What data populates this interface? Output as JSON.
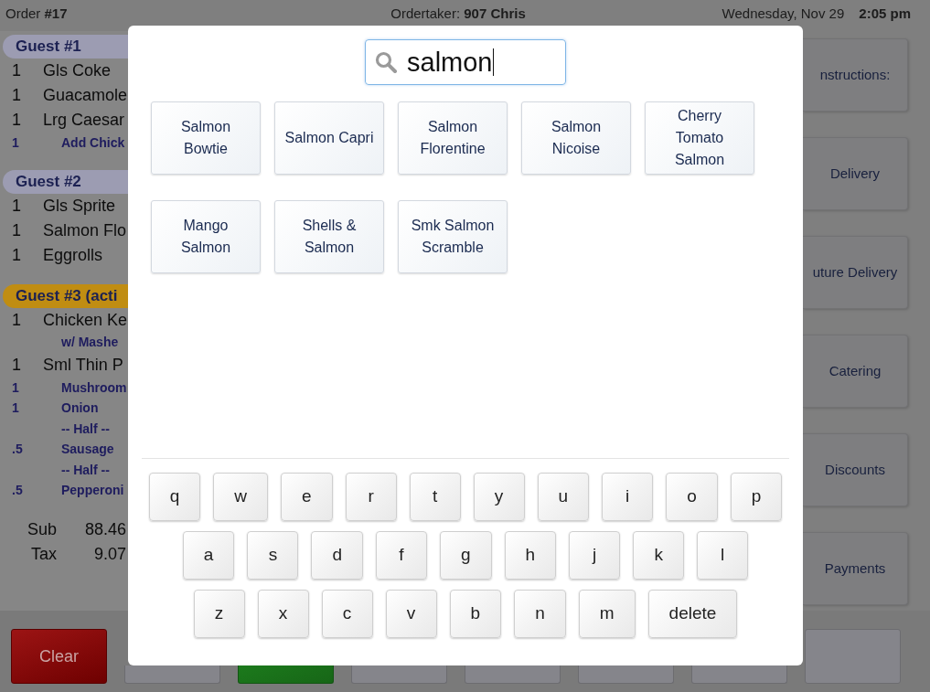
{
  "header": {
    "order": "Order **#17**",
    "ordertaker": "Ordertaker: **907 Chris**",
    "date": "Wednesday, Nov 29",
    "time": "2:05 pm"
  },
  "order_panel": {
    "guests": [
      {
        "label": "Guest #1",
        "active": false,
        "lines": [
          {
            "kind": "item",
            "qty": "1",
            "name": "Gls Coke"
          },
          {
            "kind": "item",
            "qty": "1",
            "name": "Guacamole"
          },
          {
            "kind": "item",
            "qty": "1",
            "name": "Lrg Caesar"
          },
          {
            "kind": "modifier",
            "qty": "1",
            "name": "Add Chick"
          }
        ]
      },
      {
        "label": "Guest #2",
        "active": false,
        "lines": [
          {
            "kind": "item",
            "qty": "1",
            "name": "Gls Sprite"
          },
          {
            "kind": "item",
            "qty": "1",
            "name": "Salmon Flo"
          },
          {
            "kind": "item",
            "qty": "1",
            "name": "Eggrolls"
          }
        ]
      },
      {
        "label": "Guest #3 (acti",
        "active": true,
        "lines": [
          {
            "kind": "item",
            "qty": "1",
            "name": "Chicken Ke"
          },
          {
            "kind": "modifier",
            "name": "w/ Mashe"
          },
          {
            "kind": "item",
            "qty": "1",
            "name": "Sml Thin P"
          },
          {
            "kind": "modifier",
            "qty": "1",
            "name": "Mushroom"
          },
          {
            "kind": "modifier",
            "qty": "1",
            "name": "Onion"
          },
          {
            "kind": "modifier",
            "name": "-- Half --"
          },
          {
            "kind": "modifier",
            "qty": ".5",
            "name": "Sausage"
          },
          {
            "kind": "modifier",
            "name": "-- Half --"
          },
          {
            "kind": "modifier",
            "qty": ".5",
            "name": "Pepperoni"
          }
        ]
      }
    ],
    "totals": [
      {
        "label": "Sub",
        "value": "88.46"
      },
      {
        "label": "Tax",
        "value": "9.07"
      }
    ]
  },
  "side_buttons": [
    {
      "label": "nstructions:"
    },
    {
      "label": "Delivery"
    },
    {
      "label": "uture Delivery"
    },
    {
      "label": "Catering"
    },
    {
      "label": "Discounts"
    },
    {
      "label": "Payments"
    }
  ],
  "footer_buttons": [
    {
      "kind": "danger",
      "label": "Clear"
    },
    {
      "kind": "plain"
    },
    {
      "kind": "confirm"
    },
    {
      "kind": "plain"
    },
    {
      "kind": "plain"
    },
    {
      "kind": "plain"
    },
    {
      "kind": "plain"
    },
    {
      "kind": "plain"
    }
  ],
  "search_dialog": {
    "search": {
      "value": "salmon"
    },
    "results": [
      "Salmon Bowtie",
      "Salmon Capri",
      "Salmon Florentine",
      "Salmon Nicoise",
      "Cherry Tomato Salmon",
      "Mango Salmon",
      "Shells & Salmon",
      "Smk Salmon Scramble"
    ],
    "keyboard": {
      "rows": [
        [
          "q",
          "w",
          "e",
          "r",
          "t",
          "y",
          "u",
          "i",
          "o",
          "p"
        ],
        [
          "a",
          "s",
          "d",
          "f",
          "g",
          "h",
          "j",
          "k",
          "l"
        ],
        [
          "z",
          "x",
          "c",
          "v",
          "b",
          "n",
          "m",
          "delete"
        ]
      ]
    }
  }
}
